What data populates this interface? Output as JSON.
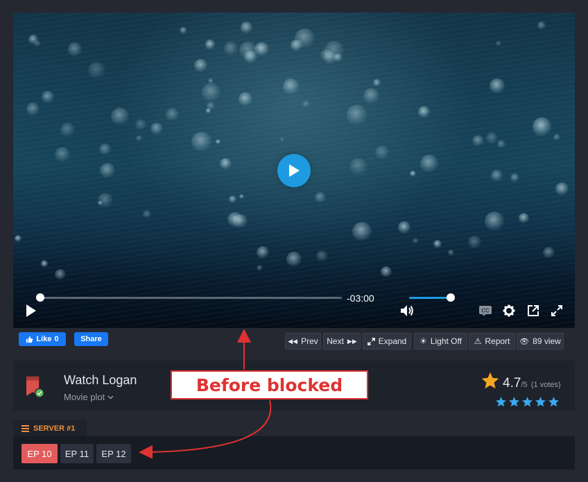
{
  "player": {
    "time_remaining": "-03:00",
    "progress": 0.0,
    "volume": 1.0
  },
  "social": {
    "like_label": "Like",
    "like_count": "0",
    "share_label": "Share"
  },
  "actions": {
    "prev": "Prev",
    "next": "Next",
    "expand": "Expand",
    "light_off": "Light Off",
    "report": "Report",
    "views": "89 view"
  },
  "movie": {
    "title": "Watch Logan",
    "plot_label": "Movie plot",
    "rating": "4.7",
    "rating_max": "/5",
    "votes": "(1 votes)",
    "stars": 5
  },
  "annotation": {
    "label": "Before blocked"
  },
  "server": {
    "label": "SERVER #1",
    "episodes": [
      {
        "label": "EP 10",
        "active": true
      },
      {
        "label": "EP 11",
        "active": false
      },
      {
        "label": "EP 12",
        "active": false
      }
    ]
  },
  "colors": {
    "accent_blue": "#1e9be0",
    "server_orange": "#f0913a",
    "active_episode": "#e45b5b",
    "annotation_red": "#e03232",
    "star_gold": "#f5a623",
    "star_blue": "#3aa9f0"
  }
}
